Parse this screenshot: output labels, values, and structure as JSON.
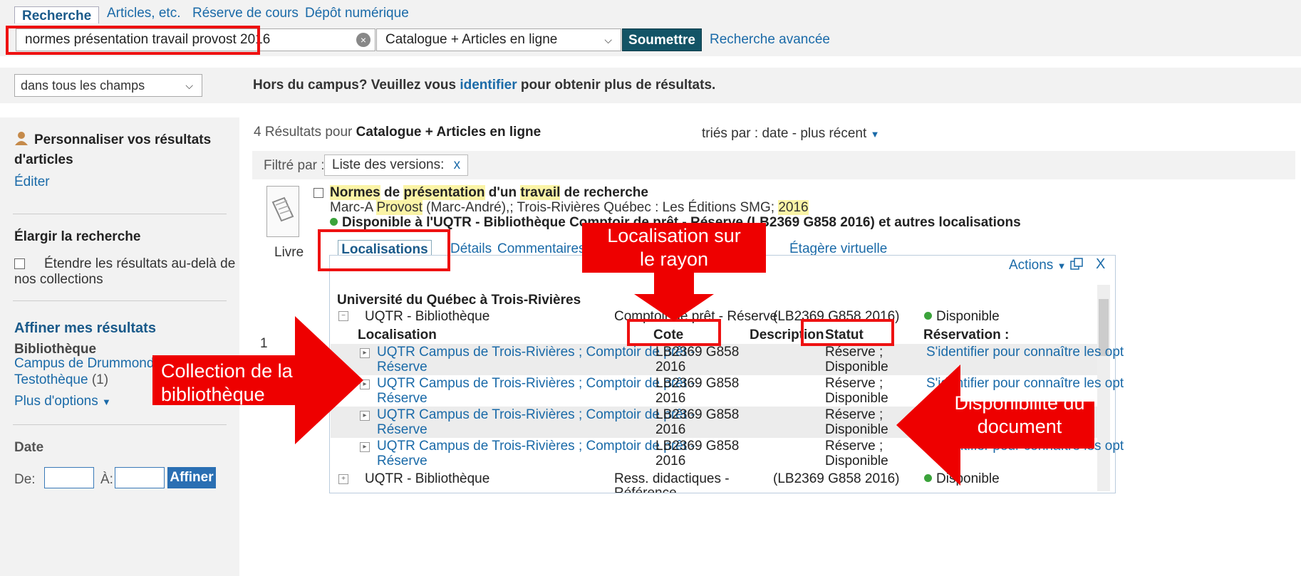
{
  "top_tabs": [
    "Recherche",
    "Articles, etc.",
    "Réserve de cours",
    "Dépôt numérique"
  ],
  "search": {
    "query": "normes présentation travail provost 2016",
    "scope": "Catalogue + Articles en ligne",
    "submit_label": "Soumettre",
    "advanced_label": "Recherche avancée",
    "field_scope": "dans tous les champs",
    "offcampus_prefix": "Hors du campus? Veuillez vous ",
    "offcampus_link": "identifier",
    "offcampus_suffix": " pour obtenir plus de résultats."
  },
  "sidebar": {
    "personalize_title": "Personnaliser vos résultats",
    "personalize_title2": "d'articles",
    "edit_link": "Éditer",
    "broaden_title": "Élargir la recherche",
    "extend_label1": "Étendre les résultats au-delà de",
    "extend_label2": "nos collections",
    "refine_title": "Affiner mes résultats",
    "library_heading": "Bibliothèque",
    "library_items": [
      {
        "label": "Campus de Drummondvi",
        "count": ""
      },
      {
        "label": "Testothèque",
        "count": "(1)"
      }
    ],
    "more_options": "Plus d'options",
    "date_heading": "Date",
    "date_from": "De:",
    "date_to": "À:",
    "refine_button": "Affiner"
  },
  "results": {
    "count": "4",
    "count_label": " Résultats  pour ",
    "scope": "Catalogue + Articles en ligne",
    "sort_label": "triés par :  date - plus récent",
    "filtered_by": "Filtré par :",
    "filter_chip": "Liste des versions:",
    "filter_remove": "x",
    "item_number": "1",
    "type_label": "Livre",
    "title_parts": [
      "Normes",
      " de ",
      "présentation",
      " d'un ",
      "travail",
      " de recherche"
    ],
    "author_parts": [
      "Marc-A ",
      "Provost",
      " (Marc-André),; Trois-Rivières Québec : Les Éditions SMG; ",
      "2016"
    ],
    "availability": "Disponible à l'UQTR - Bibliothèque Comptoir de prêt - Réserve (LB2369 G858 2016) et autres localisations",
    "detail_tabs": [
      "Localisations",
      "Détails",
      "Commentaires e",
      "Étagère virtuelle"
    ],
    "actions_label": "Actions",
    "close_label": "X"
  },
  "locations": {
    "institution": "Université du Québec à Trois-Rivières",
    "group1": {
      "library": "UQTR - Bibliothèque",
      "location": "Comptoir de prêt - Réserve",
      "callno": "(LB2369 G858 2016)",
      "status": "Disponible"
    },
    "headers": {
      "localisation": "Localisation",
      "cote": "Cote",
      "description": "Description",
      "statut": "Statut",
      "reservation": "Réservation :"
    },
    "rows": [
      {
        "loc1": "UQTR Campus de Trois-Rivières ; Comptoir de prêt -",
        "loc2": "Réserve",
        "cote1": "LB2369 G858",
        "cote2": "2016",
        "stat1": "Réserve ;",
        "stat2": "Disponible",
        "reserve": "S'identifier pour connaître les opt"
      },
      {
        "loc1": "UQTR Campus de Trois-Rivières ; Comptoir de prêt -",
        "loc2": "Réserve",
        "cote1": "LB2369 G858",
        "cote2": "2016",
        "stat1": "Réserve ;",
        "stat2": "Disponible",
        "reserve": "S'identifier pour connaître les opt"
      },
      {
        "loc1": "UQTR Campus de Trois-Rivières ; Comptoir de prêt -",
        "loc2": "Réserve",
        "cote1": "LB2369 G858",
        "cote2": "2016",
        "stat1": "Réserve ;",
        "stat2": "Disponible",
        "reserve": ""
      },
      {
        "loc1": "UQTR Campus de Trois-Rivières ; Comptoir de prêt -",
        "loc2": "Réserve",
        "cote1": "LB2369 G858",
        "cote2": "2016",
        "stat1": "Réserve ;",
        "stat2": "Disponible",
        "reserve": "S'identifier pour connaître les opt"
      }
    ],
    "group2": {
      "library": "UQTR - Bibliothèque",
      "location1": "Ress. didactiques -",
      "location2": "Référence",
      "callno": "(LB2369 G858 2016)",
      "status": "Disponible"
    }
  },
  "annotations": {
    "shelf_line1": "Localisation sur",
    "shelf_line2": "le rayon",
    "collection_line1": "Collection de la",
    "collection_line2": "bibliothèque",
    "availability_line1": "Disponibilité du",
    "availability_line2": "document"
  },
  "colors": {
    "accent": "#1a6aa8",
    "submit": "#135466",
    "annotation": "#ee0000",
    "available": "#3ba33b",
    "highlight": "#fbf4a6"
  }
}
